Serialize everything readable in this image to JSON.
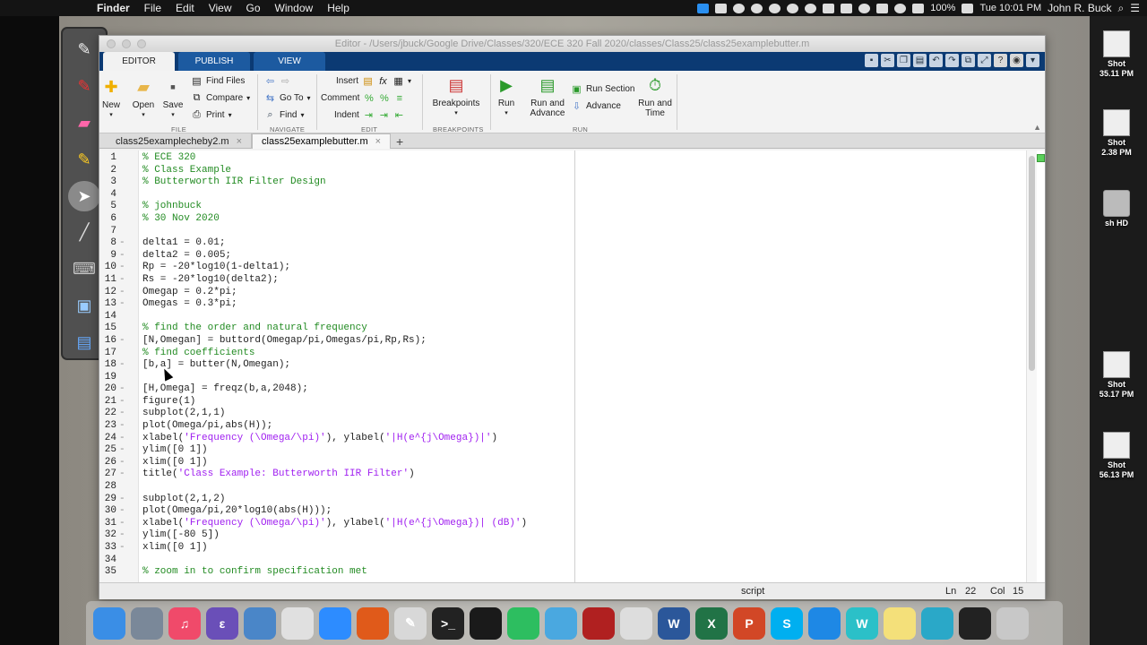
{
  "menubar": {
    "app": "Finder",
    "items": [
      "File",
      "Edit",
      "View",
      "Go",
      "Window",
      "Help"
    ],
    "battery": "100%",
    "clock": "Tue 10:01 PM",
    "user": "John R. Buck"
  },
  "window": {
    "title": "Editor - /Users/jbuck/Google Drive/Classes/320/ECE 320 Fall 2020/classes/Class25/class25examplebutter.m"
  },
  "ribbon_tabs": [
    "EDITOR",
    "PUBLISH",
    "VIEW"
  ],
  "toolstrip": {
    "new": "New",
    "open": "Open",
    "save": "Save",
    "find_files": "Find Files",
    "compare": "Compare",
    "print": "Print",
    "go_to": "Go To",
    "find": "Find",
    "insert": "Insert",
    "comment": "Comment",
    "indent": "Indent",
    "breakpoints": "Breakpoints",
    "run": "Run",
    "run_and_advance": "Run and Advance",
    "run_section": "Run Section",
    "advance": "Advance",
    "run_and_time": "Run and Time",
    "groups": {
      "file": "FILE",
      "navigate": "NAVIGATE",
      "edit": "EDIT",
      "breakpoints": "BREAKPOINTS",
      "run": "RUN"
    }
  },
  "file_tabs": [
    "class25examplecheby2.m",
    "class25examplebutter.m"
  ],
  "code_lines": [
    {
      "n": "1",
      "dash": "",
      "code": "% ECE 320",
      "type": "comment"
    },
    {
      "n": "2",
      "dash": "",
      "code": "% Class Example",
      "type": "comment"
    },
    {
      "n": "3",
      "dash": "",
      "code": "% Butterworth IIR Filter Design",
      "type": "comment"
    },
    {
      "n": "4",
      "dash": "",
      "code": "",
      "type": "plain"
    },
    {
      "n": "5",
      "dash": "",
      "code": "% johnbuck",
      "type": "comment"
    },
    {
      "n": "6",
      "dash": "",
      "code": "% 30 Nov 2020",
      "type": "comment"
    },
    {
      "n": "7",
      "dash": "",
      "code": "",
      "type": "plain"
    },
    {
      "n": "8",
      "dash": "-",
      "code": "delta1 = 0.01;",
      "type": "plain"
    },
    {
      "n": "9",
      "dash": "-",
      "code": "delta2 = 0.005;",
      "type": "plain"
    },
    {
      "n": "10",
      "dash": "-",
      "code": "Rp = -20*log10(1-delta1);",
      "type": "plain"
    },
    {
      "n": "11",
      "dash": "-",
      "code": "Rs = -20*log10(delta2);",
      "type": "plain"
    },
    {
      "n": "12",
      "dash": "-",
      "code": "Omegap = 0.2*pi;",
      "type": "plain"
    },
    {
      "n": "13",
      "dash": "-",
      "code": "Omegas = 0.3*pi;",
      "type": "plain"
    },
    {
      "n": "14",
      "dash": "",
      "code": "",
      "type": "plain"
    },
    {
      "n": "15",
      "dash": "",
      "code": "% find the order and natural frequency",
      "type": "comment"
    },
    {
      "n": "16",
      "dash": "-",
      "code": "[N,Omegan] = buttord(Omegap/pi,Omegas/pi,Rp,Rs);",
      "type": "plain"
    },
    {
      "n": "17",
      "dash": "",
      "code": "% find coefficients",
      "type": "comment"
    },
    {
      "n": "18",
      "dash": "-",
      "code": "[b,a] = butter(N,Omegan);",
      "type": "plain"
    },
    {
      "n": "19",
      "dash": "",
      "code": "",
      "type": "plain"
    },
    {
      "n": "20",
      "dash": "-",
      "code": "[H,Omega] = freqz(b,a,2048);",
      "type": "plain"
    },
    {
      "n": "21",
      "dash": "-",
      "code": "figure(1)",
      "type": "plain"
    },
    {
      "n": "22",
      "dash": "-",
      "code": "subplot(2,1,1)",
      "type": "plain"
    },
    {
      "n": "23",
      "dash": "-",
      "code": "plot(Omega/pi,abs(H));",
      "type": "plain"
    },
    {
      "n": "24",
      "dash": "-",
      "type": "mixed",
      "parts": [
        [
          "xlabel(",
          ""
        ],
        [
          "'Frequency (\\Omega/\\pi)'",
          "str"
        ],
        [
          "), ylabel(",
          ""
        ],
        [
          "'|H(e^{j\\Omega})|'",
          "str"
        ],
        [
          ")",
          ""
        ]
      ]
    },
    {
      "n": "25",
      "dash": "-",
      "code": "ylim([0 1])",
      "type": "plain"
    },
    {
      "n": "26",
      "dash": "-",
      "code": "xlim([0 1])",
      "type": "plain"
    },
    {
      "n": "27",
      "dash": "-",
      "type": "mixed",
      "parts": [
        [
          "title(",
          ""
        ],
        [
          "'Class Example: Butterworth IIR Filter'",
          "str"
        ],
        [
          ")",
          ""
        ]
      ]
    },
    {
      "n": "28",
      "dash": "",
      "code": "",
      "type": "plain"
    },
    {
      "n": "29",
      "dash": "-",
      "code": "subplot(2,1,2)",
      "type": "plain"
    },
    {
      "n": "30",
      "dash": "-",
      "code": "plot(Omega/pi,20*log10(abs(H)));",
      "type": "plain"
    },
    {
      "n": "31",
      "dash": "-",
      "type": "mixed",
      "parts": [
        [
          "xlabel(",
          ""
        ],
        [
          "'Frequency (\\Omega/\\pi)'",
          "str"
        ],
        [
          "), ylabel(",
          ""
        ],
        [
          "'|H(e^{j\\Omega})| (dB)'",
          "str"
        ],
        [
          ")",
          ""
        ]
      ]
    },
    {
      "n": "32",
      "dash": "-",
      "code": "ylim([-80 5])",
      "type": "plain"
    },
    {
      "n": "33",
      "dash": "-",
      "code": "xlim([0 1])",
      "type": "plain"
    },
    {
      "n": "34",
      "dash": "",
      "code": "",
      "type": "plain"
    },
    {
      "n": "35",
      "dash": "",
      "code": "% zoom in to confirm specification met",
      "type": "comment"
    }
  ],
  "status": {
    "mode": "script",
    "ln_label": "Ln",
    "ln_value": "22",
    "col_label": "Col",
    "col_value": "15"
  },
  "desktop_items": [
    "Shot\n35.11 PM",
    "Shot\n2.38 PM",
    "sh HD",
    "Shot\n53.17 PM",
    "Shot\n56.13 PM"
  ],
  "palette_tools": [
    "pen-tool-icon",
    "marker-red-icon",
    "eraser-icon",
    "highlighter-icon",
    "pointer-icon",
    "brush-icon",
    "keyboard-icon",
    "screen-icon",
    "desktop-icon"
  ],
  "dock_apps": [
    {
      "name": "finder",
      "label": "",
      "color": "#3a8ee6"
    },
    {
      "name": "launchpad",
      "label": "",
      "color": "#7a8899"
    },
    {
      "name": "music",
      "label": "♫",
      "color": "#f04a6a"
    },
    {
      "name": "emacs",
      "label": "ε",
      "color": "#6a4fb8"
    },
    {
      "name": "preview",
      "label": "",
      "color": "#4a86c8"
    },
    {
      "name": "chrome",
      "label": "",
      "color": "#e0e0e0"
    },
    {
      "name": "zoom",
      "label": "",
      "color": "#2d8cff"
    },
    {
      "name": "matlab",
      "label": "",
      "color": "#e05a1a"
    },
    {
      "name": "notes",
      "label": "✎",
      "color": "#d8d8d8"
    },
    {
      "name": "terminal",
      "label": ">_",
      "color": "#222222"
    },
    {
      "name": "acrobat",
      "label": "",
      "color": "#1a1a1a"
    },
    {
      "name": "evernote",
      "label": "",
      "color": "#2dbe60"
    },
    {
      "name": "messages",
      "label": "",
      "color": "#4aa8e0"
    },
    {
      "name": "photo-booth",
      "label": "",
      "color": "#b02020"
    },
    {
      "name": "screenshot",
      "label": "",
      "color": "#dddddd"
    },
    {
      "name": "word",
      "label": "W",
      "color": "#2b579a"
    },
    {
      "name": "excel",
      "label": "X",
      "color": "#217346"
    },
    {
      "name": "powerpoint",
      "label": "P",
      "color": "#d24726"
    },
    {
      "name": "skype",
      "label": "S",
      "color": "#00aff0"
    },
    {
      "name": "safari",
      "label": "",
      "color": "#1e88e5"
    },
    {
      "name": "webex",
      "label": "W",
      "color": "#2bc0c8"
    },
    {
      "name": "stickies",
      "label": "",
      "color": "#f4e07a"
    },
    {
      "name": "settings",
      "label": "",
      "color": "#2aa8c8"
    },
    {
      "name": "display",
      "label": "",
      "color": "#222222"
    },
    {
      "name": "trash",
      "label": "",
      "color": "#c8c8c8"
    }
  ]
}
